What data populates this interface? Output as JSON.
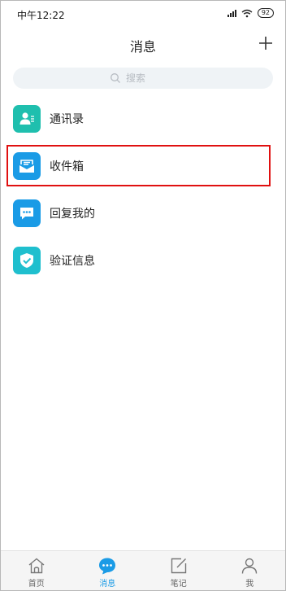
{
  "status_bar": {
    "time": "中午12:22",
    "battery": "92"
  },
  "header": {
    "title": "消息",
    "add_icon": "plus-icon"
  },
  "search": {
    "placeholder": "搜索"
  },
  "menu": {
    "items": [
      {
        "label": "通讯录",
        "icon": "contacts-icon",
        "color": "#1fbfae"
      },
      {
        "label": "收件箱",
        "icon": "inbox-icon",
        "color": "#1a9be6"
      },
      {
        "label": "回复我的",
        "icon": "reply-icon",
        "color": "#1a9be6"
      },
      {
        "label": "验证信息",
        "icon": "verify-shield-icon",
        "color": "#1fbfce"
      }
    ],
    "highlighted_index": 1
  },
  "tabbar": {
    "tabs": [
      {
        "label": "首页",
        "icon": "home-icon",
        "active": false
      },
      {
        "label": "消息",
        "icon": "message-icon",
        "active": true
      },
      {
        "label": "笔记",
        "icon": "note-icon",
        "active": false
      },
      {
        "label": "我",
        "icon": "profile-icon",
        "active": false
      }
    ]
  },
  "colors": {
    "accent": "#1a9be6",
    "highlight_border": "#e01010"
  }
}
